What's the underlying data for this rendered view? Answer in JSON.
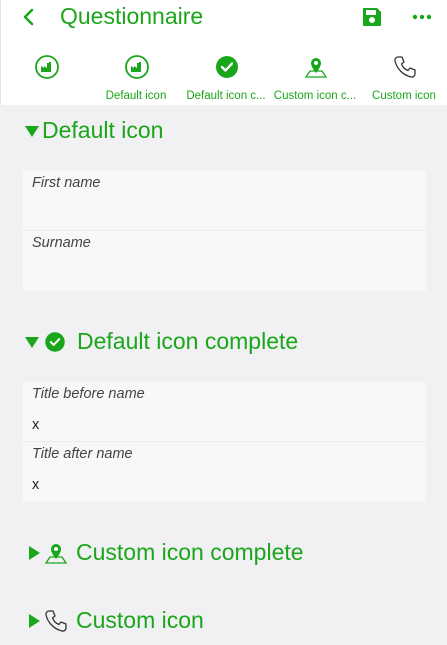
{
  "header": {
    "title": "Questionnaire",
    "back_icon": "chevron-left-icon",
    "save_icon": "floppy-disk-icon",
    "more_icon": "ellipsis-icon"
  },
  "tabs": [
    {
      "label": "",
      "icon": "factory-circle-icon"
    },
    {
      "label": "Default icon",
      "icon": "factory-circle-icon"
    },
    {
      "label": "Default icon c...",
      "icon": "check-circle-icon"
    },
    {
      "label": "Custom icon c...",
      "icon": "map-pin-icon"
    },
    {
      "label": "Custom icon",
      "icon": "phone-icon"
    }
  ],
  "sections": [
    {
      "title": "Default icon",
      "expanded": true,
      "fields": [
        {
          "label": "First name",
          "value": ""
        },
        {
          "label": "Surname",
          "value": ""
        }
      ]
    },
    {
      "title": "Default icon complete",
      "expanded": true,
      "icon": "check-circle-icon",
      "fields": [
        {
          "label": "Title before name",
          "value": "x"
        },
        {
          "label": "Title after name",
          "value": "x"
        }
      ]
    },
    {
      "title": "Custom icon complete",
      "expanded": false,
      "icon": "map-pin-icon"
    },
    {
      "title": "Custom icon",
      "expanded": false,
      "icon": "phone-icon"
    }
  ],
  "colors": {
    "accent": "#1aa61a",
    "background": "#f1f1f3",
    "card": "#f8f8f9"
  }
}
